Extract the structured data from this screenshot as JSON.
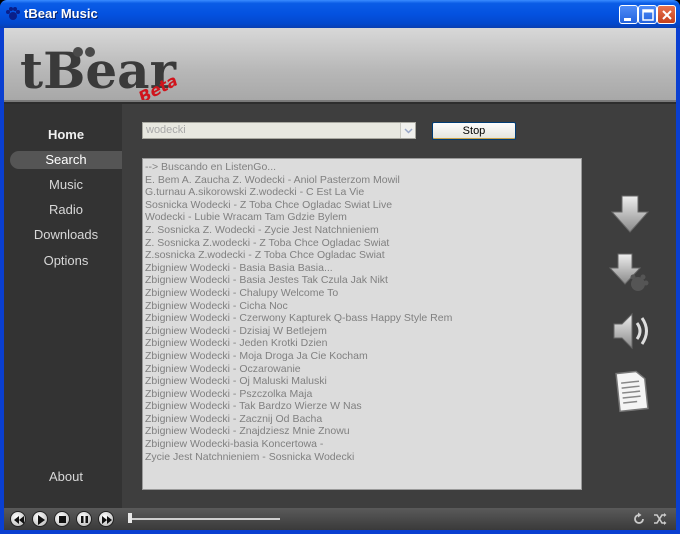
{
  "window": {
    "title": "tBear Music",
    "controls": [
      "minimize",
      "maximize",
      "close"
    ]
  },
  "logo": {
    "text": "tBear",
    "badge": "Beta"
  },
  "nav": {
    "items": [
      {
        "label": "Home"
      },
      {
        "label": "Search",
        "active": true
      },
      {
        "label": "Music"
      },
      {
        "label": "Radio"
      },
      {
        "label": "Downloads"
      },
      {
        "label": "Options"
      }
    ],
    "about_label": "About"
  },
  "search": {
    "value": "wodecki",
    "stop_label": "Stop"
  },
  "results": [
    "--> Buscando en ListenGo...",
    "E. Bem A. Zaucha Z. Wodecki - Aniol Pasterzom Mowil",
    "G.turnau A.sikorowski Z.wodecki - C Est La Vie",
    "Sosnicka Wodecki - Z Toba Chce Ogladac Swiat Live",
    "Wodecki - Lubie Wracam Tam Gdzie Bylem",
    "Z. Sosnicka Z. Wodecki - Zycie Jest Natchnieniem",
    "Z. Sosnicka Z.wodecki - Z Toba Chce Ogladac Swiat",
    "Z.sosnicka Z.wodecki - Z Toba Chce Ogladac Swiat",
    "Zbigniew Wodecki - Basia Basia Basia...",
    "Zbigniew Wodecki - Basia Jestes Tak Czula Jak Nikt",
    "Zbigniew Wodecki - Chalupy Welcome To",
    "Zbigniew Wodecki - Cicha Noc",
    "Zbigniew Wodecki - Czerwony Kapturek Q-bass Happy Style Rem",
    "Zbigniew Wodecki - Dzisiaj W Betlejem",
    "Zbigniew Wodecki - Jeden Krotki Dzien",
    "Zbigniew Wodecki - Moja Droga Ja Cie Kocham",
    "Zbigniew Wodecki - Oczarowanie",
    "Zbigniew Wodecki - Oj Maluski Maluski",
    "Zbigniew Wodecki - Pszczolka Maja",
    "Zbigniew Wodecki - Tak Bardzo Wierze W Nas",
    "Zbigniew Wodecki - Zacznij Od Bacha",
    "Zbigniew Wodecki - Znajdziesz Mnie Znowu",
    "Zbigniew Wodecki-basia Koncertowa -",
    "Zycie Jest Natchnieniem - Sosnicka Wodecki"
  ],
  "actions": [
    "download-arrow-icon",
    "download-bear-icon",
    "speaker-icon",
    "document-icon"
  ],
  "player": {
    "buttons": [
      "previous-icon",
      "play-icon",
      "stop-icon",
      "pause-icon",
      "next-icon"
    ],
    "progress": 0,
    "extra_icons": [
      "repeat-icon",
      "shuffle-icon"
    ]
  },
  "colors": {
    "titlebar": "#0452e0",
    "background": "#2d2d2d",
    "logo_badge": "#d0141c"
  }
}
